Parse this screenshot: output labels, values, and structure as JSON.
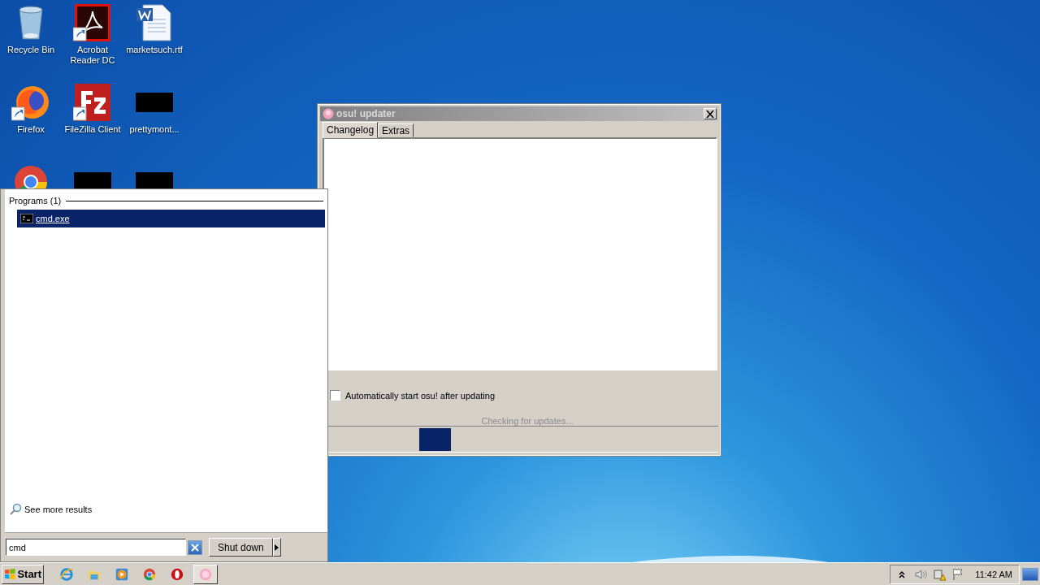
{
  "desktop": {
    "icons": [
      {
        "kind": "recycle-bin",
        "label": "Recycle Bin",
        "shortcut": false
      },
      {
        "kind": "pdf",
        "label": "Acrobat Reader DC",
        "shortcut": true
      },
      {
        "kind": "document",
        "label": "marketsuch.rtf",
        "shortcut": false
      },
      {
        "kind": "fox",
        "label": "Firefox",
        "shortcut": true
      },
      {
        "kind": "ftp",
        "label": "FileZilla Client",
        "shortcut": true
      },
      {
        "kind": "redacted",
        "label": "prettymont...",
        "shortcut": false
      },
      {
        "kind": "chrome",
        "shortcut": false
      },
      {
        "kind": "redacted",
        "shortcut": false
      },
      {
        "kind": "redacted",
        "shortcut": false
      }
    ]
  },
  "updater": {
    "title": "osu! updater",
    "tabs": [
      {
        "label": "Changelog",
        "selected": true
      },
      {
        "label": "Extras",
        "selected": false
      }
    ],
    "auto_start": {
      "label": "Automatically start osu! after updating",
      "checked": false
    },
    "status": "Checking for updates..."
  },
  "start_menu": {
    "group": "Programs (1)",
    "results": [
      {
        "label": "cmd.exe",
        "selected": true
      }
    ],
    "more": "See more results",
    "search": {
      "value": "cmd"
    },
    "shutdown": "Shut down"
  },
  "taskbar": {
    "start": "Start",
    "apps": [
      {
        "kind": "ie",
        "active": false
      },
      {
        "kind": "explorer",
        "active": false
      },
      {
        "kind": "media",
        "active": false
      },
      {
        "kind": "chrome",
        "active": false
      },
      {
        "kind": "opera",
        "active": false
      },
      {
        "kind": "osu",
        "active": true
      }
    ],
    "clock": "11:42 AM"
  }
}
